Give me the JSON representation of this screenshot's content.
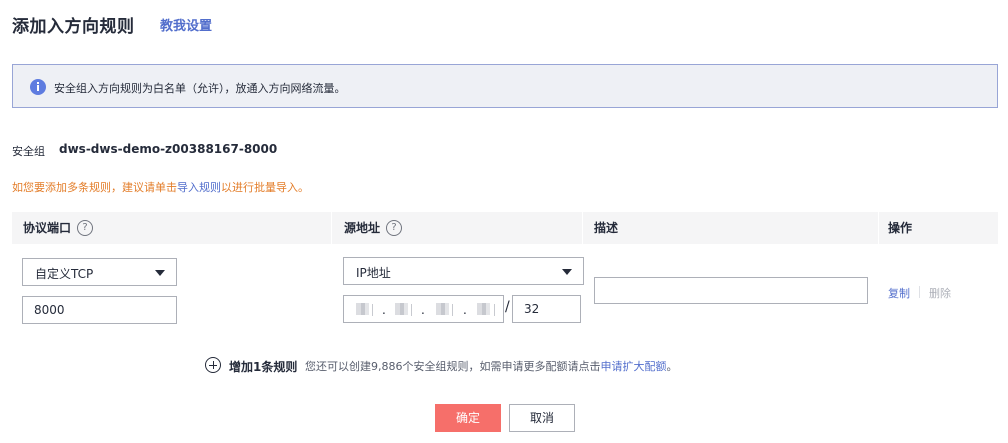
{
  "header": {
    "title": "添加入方向规则",
    "guide_link": "教我设置"
  },
  "info": {
    "text": "安全组入方向规则为白名单（允许），放通入方向网络流量。"
  },
  "security_group": {
    "label": "安全组",
    "name": "dws-dws-demo-z00388167-8000"
  },
  "notice": {
    "prefix": "如您要添加多条规则，建议请单击",
    "link": "导入规则",
    "suffix": "以进行批量导入。"
  },
  "table": {
    "headers": {
      "protocol_port": "协议端口",
      "source": "源地址",
      "description": "描述",
      "operation": "操作"
    },
    "help_glyph": "?"
  },
  "row": {
    "protocol": "自定义TCP",
    "port": "8000",
    "source_type": "IP地址",
    "ip_dot": ".",
    "slash": "/",
    "mask": "32",
    "description": "",
    "copy": "复制",
    "delete": "删除"
  },
  "footer": {
    "add_rule": "增加1条规则",
    "quota_prefix": "您还可以创建9,886个安全组规则，如需申请更多配额请点击",
    "quota_link": "申请扩大配额",
    "quota_suffix": "。",
    "ok": "确定",
    "cancel": "取消"
  },
  "colors": {
    "accent": "#526ecc",
    "warning": "#e37d29",
    "primary_button": "#f66f6a",
    "info_border": "#98a5d6",
    "info_bg": "#eef0f5"
  }
}
